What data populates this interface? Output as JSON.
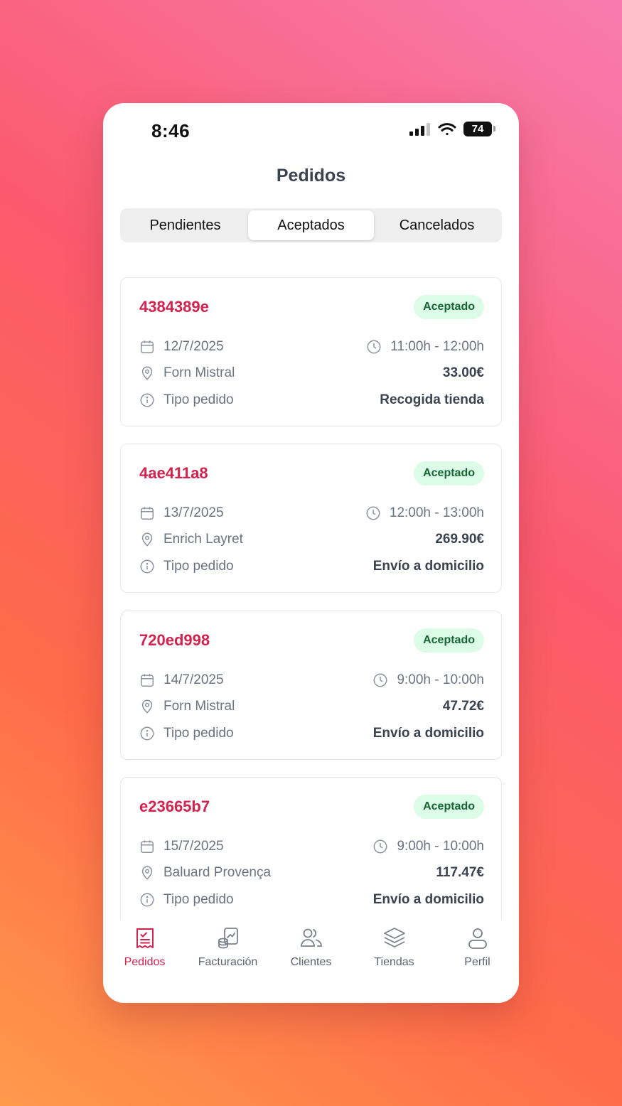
{
  "status_bar": {
    "time": "8:46",
    "battery": "74"
  },
  "header": {
    "title": "Pedidos"
  },
  "tabs": [
    {
      "label": "Pendientes",
      "active": false
    },
    {
      "label": "Aceptados",
      "active": true
    },
    {
      "label": "Cancelados",
      "active": false
    }
  ],
  "orders": [
    {
      "id": "4384389e",
      "status": "Aceptado",
      "date": "12/7/2025",
      "time": "11:00h - 12:00h",
      "store": "Forn Mistral",
      "total": "33.00€",
      "type_label": "Tipo pedido",
      "type": "Recogida tienda"
    },
    {
      "id": "4ae411a8",
      "status": "Aceptado",
      "date": "13/7/2025",
      "time": "12:00h - 13:00h",
      "store": "Enrich Layret",
      "total": "269.90€",
      "type_label": "Tipo pedido",
      "type": "Envío a domicilio"
    },
    {
      "id": "720ed998",
      "status": "Aceptado",
      "date": "14/7/2025",
      "time": "9:00h - 10:00h",
      "store": "Forn Mistral",
      "total": "47.72€",
      "type_label": "Tipo pedido",
      "type": "Envío a domicilio"
    },
    {
      "id": "e23665b7",
      "status": "Aceptado",
      "date": "15/7/2025",
      "time": "9:00h - 10:00h",
      "store": "Baluard Provença",
      "total": "117.47€",
      "type_label": "Tipo pedido",
      "type": "Envío a domicilio"
    }
  ],
  "bottom_nav": [
    {
      "label": "Pedidos",
      "icon": "receipt-icon",
      "active": true
    },
    {
      "label": "Facturación",
      "icon": "billing-icon",
      "active": false
    },
    {
      "label": "Clientes",
      "icon": "users-icon",
      "active": false
    },
    {
      "label": "Tiendas",
      "icon": "layers-icon",
      "active": false
    },
    {
      "label": "Perfil",
      "icon": "user-icon",
      "active": false
    }
  ],
  "colors": {
    "accent": "#d3224e",
    "badge_bg": "#dcfce7",
    "badge_text": "#166534",
    "text_dark": "#3b4351",
    "text_muted": "#6b7280"
  }
}
